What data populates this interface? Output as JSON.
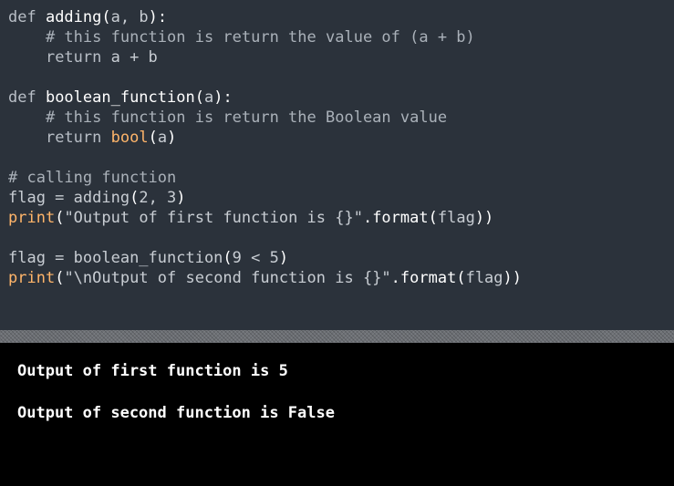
{
  "code": {
    "l1": {
      "kw": "def ",
      "fn": "adding",
      "p1": "(",
      "params": "a, b",
      "p2": "):"
    },
    "l2": {
      "indent": "    ",
      "comment": "# this function is return the value of (a + b)"
    },
    "l3": {
      "indent": "    ",
      "kw": "return",
      "rest": " a + b"
    },
    "l5": {
      "kw": "def ",
      "fn": "boolean_function",
      "p1": "(",
      "params": "a",
      "p2": "):"
    },
    "l6": {
      "indent": "    ",
      "comment": "# this function is return the Boolean value"
    },
    "l7": {
      "indent": "    ",
      "kw": "return",
      "sp": " ",
      "builtin": "bool",
      "p1": "(",
      "arg": "a",
      "p2": ")"
    },
    "l9": {
      "comment": "# calling function"
    },
    "l10": {
      "var": "flag = ",
      "fn": "adding",
      "p1": "(",
      "args": "2, 3",
      "p2": ")"
    },
    "l11": {
      "builtin": "print",
      "p1": "(",
      "str": "\"Output of first function is {}\"",
      "method": ".format",
      "p2": "(",
      "arg": "flag",
      "p3": "))"
    },
    "l13": {
      "var": "flag = ",
      "fn": "boolean_function",
      "p1": "(",
      "args": "9 < 5",
      "p2": ")"
    },
    "l14": {
      "builtin": "print",
      "p1": "(",
      "str": "\"\\nOutput of second function is {}\"",
      "method": ".format",
      "p2": "(",
      "arg": "flag",
      "p3": "))"
    }
  },
  "console": {
    "out1": "Output of first function is 5",
    "out2": "Output of second function is False"
  },
  "colors": {
    "editor_bg": "#2b323b",
    "console_bg": "#000000",
    "builtin": "#ffb56a"
  }
}
